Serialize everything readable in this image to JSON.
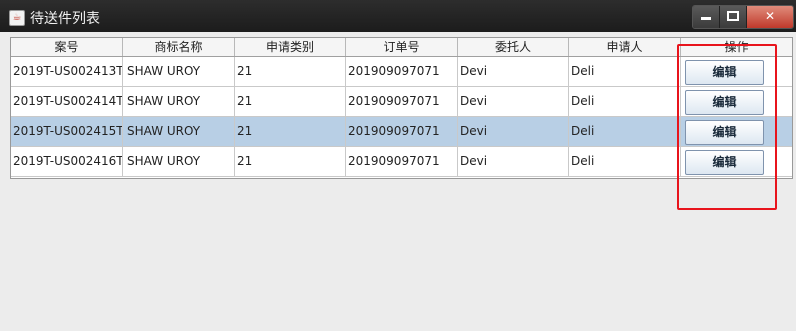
{
  "window": {
    "title": "待送件列表"
  },
  "table": {
    "columns": [
      "案号",
      "商标名称",
      "申请类别",
      "订单号",
      "委托人",
      "申请人",
      "操作"
    ],
    "rows": [
      {
        "case_no": "2019T-US002413T",
        "trademark": "SHAW UROY",
        "class": "21",
        "order_no": "201909097071",
        "client": "Devi",
        "applicant": "Deli",
        "action": "编辑",
        "selected": false
      },
      {
        "case_no": "2019T-US002414T",
        "trademark": "SHAW UROY",
        "class": "21",
        "order_no": "201909097071",
        "client": "Devi",
        "applicant": "Deli",
        "action": "编辑",
        "selected": false
      },
      {
        "case_no": "2019T-US002415T",
        "trademark": "SHAW UROY",
        "class": "21",
        "order_no": "201909097071",
        "client": "Devi",
        "applicant": "Deli",
        "action": "编辑",
        "selected": true
      },
      {
        "case_no": "2019T-US002416T",
        "trademark": "SHAW UROY",
        "class": "21",
        "order_no": "201909097071",
        "client": "Devi",
        "applicant": "Deli",
        "action": "编辑",
        "selected": false
      }
    ]
  },
  "colors": {
    "selected_row": "#b8cfe5",
    "highlight": "#e8141c"
  }
}
